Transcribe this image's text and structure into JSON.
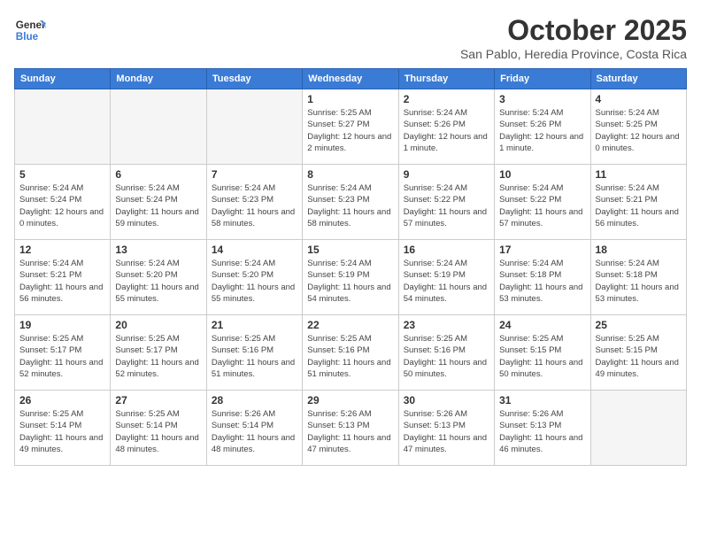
{
  "header": {
    "logo_line1": "General",
    "logo_line2": "Blue",
    "month": "October 2025",
    "location": "San Pablo, Heredia Province, Costa Rica"
  },
  "weekdays": [
    "Sunday",
    "Monday",
    "Tuesday",
    "Wednesday",
    "Thursday",
    "Friday",
    "Saturday"
  ],
  "weeks": [
    [
      {
        "day": "",
        "empty": true
      },
      {
        "day": "",
        "empty": true
      },
      {
        "day": "",
        "empty": true
      },
      {
        "day": "1",
        "sunrise": "5:25 AM",
        "sunset": "5:27 PM",
        "daylight": "12 hours and 2 minutes."
      },
      {
        "day": "2",
        "sunrise": "5:24 AM",
        "sunset": "5:26 PM",
        "daylight": "12 hours and 1 minute."
      },
      {
        "day": "3",
        "sunrise": "5:24 AM",
        "sunset": "5:26 PM",
        "daylight": "12 hours and 1 minute."
      },
      {
        "day": "4",
        "sunrise": "5:24 AM",
        "sunset": "5:25 PM",
        "daylight": "12 hours and 0 minutes."
      }
    ],
    [
      {
        "day": "5",
        "sunrise": "5:24 AM",
        "sunset": "5:24 PM",
        "daylight": "12 hours and 0 minutes."
      },
      {
        "day": "6",
        "sunrise": "5:24 AM",
        "sunset": "5:24 PM",
        "daylight": "11 hours and 59 minutes."
      },
      {
        "day": "7",
        "sunrise": "5:24 AM",
        "sunset": "5:23 PM",
        "daylight": "11 hours and 58 minutes."
      },
      {
        "day": "8",
        "sunrise": "5:24 AM",
        "sunset": "5:23 PM",
        "daylight": "11 hours and 58 minutes."
      },
      {
        "day": "9",
        "sunrise": "5:24 AM",
        "sunset": "5:22 PM",
        "daylight": "11 hours and 57 minutes."
      },
      {
        "day": "10",
        "sunrise": "5:24 AM",
        "sunset": "5:22 PM",
        "daylight": "11 hours and 57 minutes."
      },
      {
        "day": "11",
        "sunrise": "5:24 AM",
        "sunset": "5:21 PM",
        "daylight": "11 hours and 56 minutes."
      }
    ],
    [
      {
        "day": "12",
        "sunrise": "5:24 AM",
        "sunset": "5:21 PM",
        "daylight": "11 hours and 56 minutes."
      },
      {
        "day": "13",
        "sunrise": "5:24 AM",
        "sunset": "5:20 PM",
        "daylight": "11 hours and 55 minutes."
      },
      {
        "day": "14",
        "sunrise": "5:24 AM",
        "sunset": "5:20 PM",
        "daylight": "11 hours and 55 minutes."
      },
      {
        "day": "15",
        "sunrise": "5:24 AM",
        "sunset": "5:19 PM",
        "daylight": "11 hours and 54 minutes."
      },
      {
        "day": "16",
        "sunrise": "5:24 AM",
        "sunset": "5:19 PM",
        "daylight": "11 hours and 54 minutes."
      },
      {
        "day": "17",
        "sunrise": "5:24 AM",
        "sunset": "5:18 PM",
        "daylight": "11 hours and 53 minutes."
      },
      {
        "day": "18",
        "sunrise": "5:24 AM",
        "sunset": "5:18 PM",
        "daylight": "11 hours and 53 minutes."
      }
    ],
    [
      {
        "day": "19",
        "sunrise": "5:25 AM",
        "sunset": "5:17 PM",
        "daylight": "11 hours and 52 minutes."
      },
      {
        "day": "20",
        "sunrise": "5:25 AM",
        "sunset": "5:17 PM",
        "daylight": "11 hours and 52 minutes."
      },
      {
        "day": "21",
        "sunrise": "5:25 AM",
        "sunset": "5:16 PM",
        "daylight": "11 hours and 51 minutes."
      },
      {
        "day": "22",
        "sunrise": "5:25 AM",
        "sunset": "5:16 PM",
        "daylight": "11 hours and 51 minutes."
      },
      {
        "day": "23",
        "sunrise": "5:25 AM",
        "sunset": "5:16 PM",
        "daylight": "11 hours and 50 minutes."
      },
      {
        "day": "24",
        "sunrise": "5:25 AM",
        "sunset": "5:15 PM",
        "daylight": "11 hours and 50 minutes."
      },
      {
        "day": "25",
        "sunrise": "5:25 AM",
        "sunset": "5:15 PM",
        "daylight": "11 hours and 49 minutes."
      }
    ],
    [
      {
        "day": "26",
        "sunrise": "5:25 AM",
        "sunset": "5:14 PM",
        "daylight": "11 hours and 49 minutes."
      },
      {
        "day": "27",
        "sunrise": "5:25 AM",
        "sunset": "5:14 PM",
        "daylight": "11 hours and 48 minutes."
      },
      {
        "day": "28",
        "sunrise": "5:26 AM",
        "sunset": "5:14 PM",
        "daylight": "11 hours and 48 minutes."
      },
      {
        "day": "29",
        "sunrise": "5:26 AM",
        "sunset": "5:13 PM",
        "daylight": "11 hours and 47 minutes."
      },
      {
        "day": "30",
        "sunrise": "5:26 AM",
        "sunset": "5:13 PM",
        "daylight": "11 hours and 47 minutes."
      },
      {
        "day": "31",
        "sunrise": "5:26 AM",
        "sunset": "5:13 PM",
        "daylight": "11 hours and 46 minutes."
      },
      {
        "day": "",
        "empty": true
      }
    ]
  ]
}
